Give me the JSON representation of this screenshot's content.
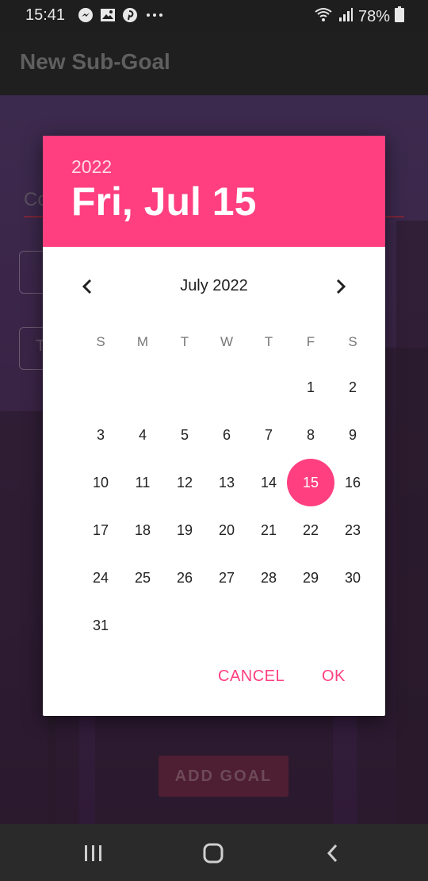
{
  "status_bar": {
    "time": "15:41",
    "battery": "78%",
    "notification_icons": [
      "messenger-icon",
      "image-icon",
      "pinterest-icon",
      "more-icon"
    ],
    "system_icons": [
      "wifi-icon",
      "signal-icon",
      "battery-icon"
    ]
  },
  "app_bar": {
    "title": "New Sub-Goal"
  },
  "background": {
    "field_partial_text": "Co",
    "box2_partial_text": "T",
    "add_goal_label": "ADD GOAL"
  },
  "date_picker": {
    "year": "2022",
    "selected_date": "Fri, Jul 15",
    "month_label": "July 2022",
    "day_headers": [
      "S",
      "M",
      "T",
      "W",
      "T",
      "F",
      "S"
    ],
    "weeks": [
      [
        "",
        "",
        "",
        "",
        "",
        "1",
        "2"
      ],
      [
        "3",
        "4",
        "5",
        "6",
        "7",
        "8",
        "9"
      ],
      [
        "10",
        "11",
        "12",
        "13",
        "14",
        "15",
        "16"
      ],
      [
        "17",
        "18",
        "19",
        "20",
        "21",
        "22",
        "23"
      ],
      [
        "24",
        "25",
        "26",
        "27",
        "28",
        "29",
        "30"
      ],
      [
        "31",
        "",
        "",
        "",
        "",
        "",
        ""
      ]
    ],
    "selected_day": "15",
    "cancel_label": "CANCEL",
    "ok_label": "OK"
  },
  "colors": {
    "accent": "#ff3f7f",
    "header_text": "#ffffff",
    "dialog_bg": "#ffffff"
  }
}
